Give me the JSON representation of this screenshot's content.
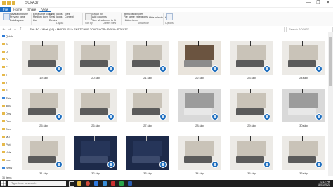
{
  "window": {
    "title": "SOFA37",
    "buttons": [
      "—",
      "❐",
      "✕"
    ]
  },
  "ribbon_tabs": [
    "File",
    "Home",
    "Share",
    "View"
  ],
  "ribbon": {
    "groups": [
      {
        "label": "Panes",
        "items": [
          "Navigation pane",
          "Preview pane",
          "Details pane"
        ]
      },
      {
        "label": "Layout",
        "items": [
          "Extra large icons",
          "Large icons",
          "Medium icons",
          "Small icons",
          "List",
          "Details",
          "Tiles",
          "Content"
        ]
      },
      {
        "label": "Current view",
        "items": [
          "Sort by",
          "Group by",
          "Add columns",
          "Size all columns to fit"
        ]
      },
      {
        "label": "Show/hide",
        "items": [
          "Item check boxes",
          "File name extensions",
          "Hidden items",
          "Hide selected items"
        ]
      },
      {
        "label": "",
        "items": [
          "Options"
        ]
      }
    ]
  },
  "address": {
    "path": "This PC  ›  Work (M:)  ›  MODEL SU  ›  SKETCHUP TONG HOP  ›  SOFA  ›  SOFA37",
    "search_placeholder": "Search SOFA37"
  },
  "nav": {
    "items": [
      {
        "label": "Quick",
        "icon": "star-icon"
      },
      {
        "label": "D",
        "icon": "folder-icon"
      },
      {
        "label": "D",
        "icon": "folder-icon"
      },
      {
        "label": "D",
        "icon": "folder-icon"
      },
      {
        "label": "P",
        "icon": "folder-icon"
      },
      {
        "label": "2",
        "icon": "folder-icon"
      },
      {
        "label": "2",
        "icon": "folder-icon"
      },
      {
        "label": "S",
        "icon": "folder-icon"
      },
      {
        "label": "This",
        "icon": "pc-icon"
      },
      {
        "label": "3D0",
        "icon": "folder-icon"
      },
      {
        "label": "Des",
        "icon": "folder-icon"
      },
      {
        "label": "Doc",
        "icon": "folder-icon"
      },
      {
        "label": "Dov",
        "icon": "folder-icon"
      },
      {
        "label": "Mu",
        "icon": "folder-icon"
      },
      {
        "label": "Pict",
        "icon": "folder-icon"
      },
      {
        "label": "Vide",
        "icon": "folder-icon"
      },
      {
        "label": "Loc",
        "icon": "folder-icon"
      },
      {
        "label": "Netw",
        "icon": "network-icon"
      }
    ]
  },
  "files": [
    {
      "name": "19.skp",
      "theme": "light"
    },
    {
      "name": "20.skp",
      "theme": "light"
    },
    {
      "name": "21.skp",
      "theme": "light"
    },
    {
      "name": "22.skp",
      "theme": "wood"
    },
    {
      "name": "23.skp",
      "theme": "light"
    },
    {
      "name": "24.skp",
      "theme": "light"
    },
    {
      "name": "25.skp",
      "theme": "light"
    },
    {
      "name": "26.skp",
      "theme": "light"
    },
    {
      "name": "27.skp",
      "theme": "light"
    },
    {
      "name": "28.skp",
      "theme": "gray"
    },
    {
      "name": "29.skp",
      "theme": "light"
    },
    {
      "name": "30.skp",
      "theme": "gray"
    },
    {
      "name": "31.skp",
      "theme": "light"
    },
    {
      "name": "32.skp",
      "theme": "dark"
    },
    {
      "name": "33.skp",
      "theme": "dark"
    },
    {
      "name": "34.skp",
      "theme": "light"
    },
    {
      "name": "35.skp",
      "theme": "light"
    },
    {
      "name": "36.skp",
      "theme": "light"
    }
  ],
  "status": {
    "count": "36 items"
  },
  "taskbar": {
    "search_placeholder": "Type here to search",
    "time": "10:12 PM",
    "date": "18/01/2021"
  },
  "colors": {
    "accent": "#1a6cc4",
    "taskbar": "#1f1f1f",
    "sketchup_badge": "#1f6fbf"
  }
}
